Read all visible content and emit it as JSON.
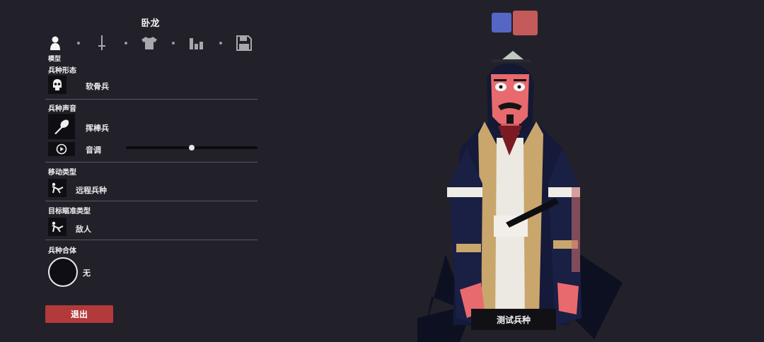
{
  "unit_name": "卧龙",
  "tabs": {
    "active_label": "模型",
    "items": [
      {
        "icon": "person-icon"
      },
      {
        "icon": "sword-icon"
      },
      {
        "icon": "shirt-icon"
      },
      {
        "icon": "stats-icon"
      },
      {
        "icon": "save-icon"
      }
    ]
  },
  "sections": {
    "unit_form": {
      "title": "兵种形态",
      "value": "软骨兵"
    },
    "unit_voice": {
      "title": "兵种声音",
      "value": "挥棒兵",
      "pitch_label": "音调",
      "pitch_level": 0.5
    },
    "movement": {
      "title": "移动类型",
      "value": "远程兵种"
    },
    "targeting": {
      "title": "目标瞄准类型",
      "value": "敌人"
    },
    "combine": {
      "title": "兵种合体",
      "value": "无"
    }
  },
  "buttons": {
    "exit": "退出",
    "test": "测试兵种"
  },
  "colors": {
    "team_blue": "#5566c4",
    "team_red": "#c45a5a",
    "exit_button": "#b23a3a",
    "background": "#22212a"
  }
}
